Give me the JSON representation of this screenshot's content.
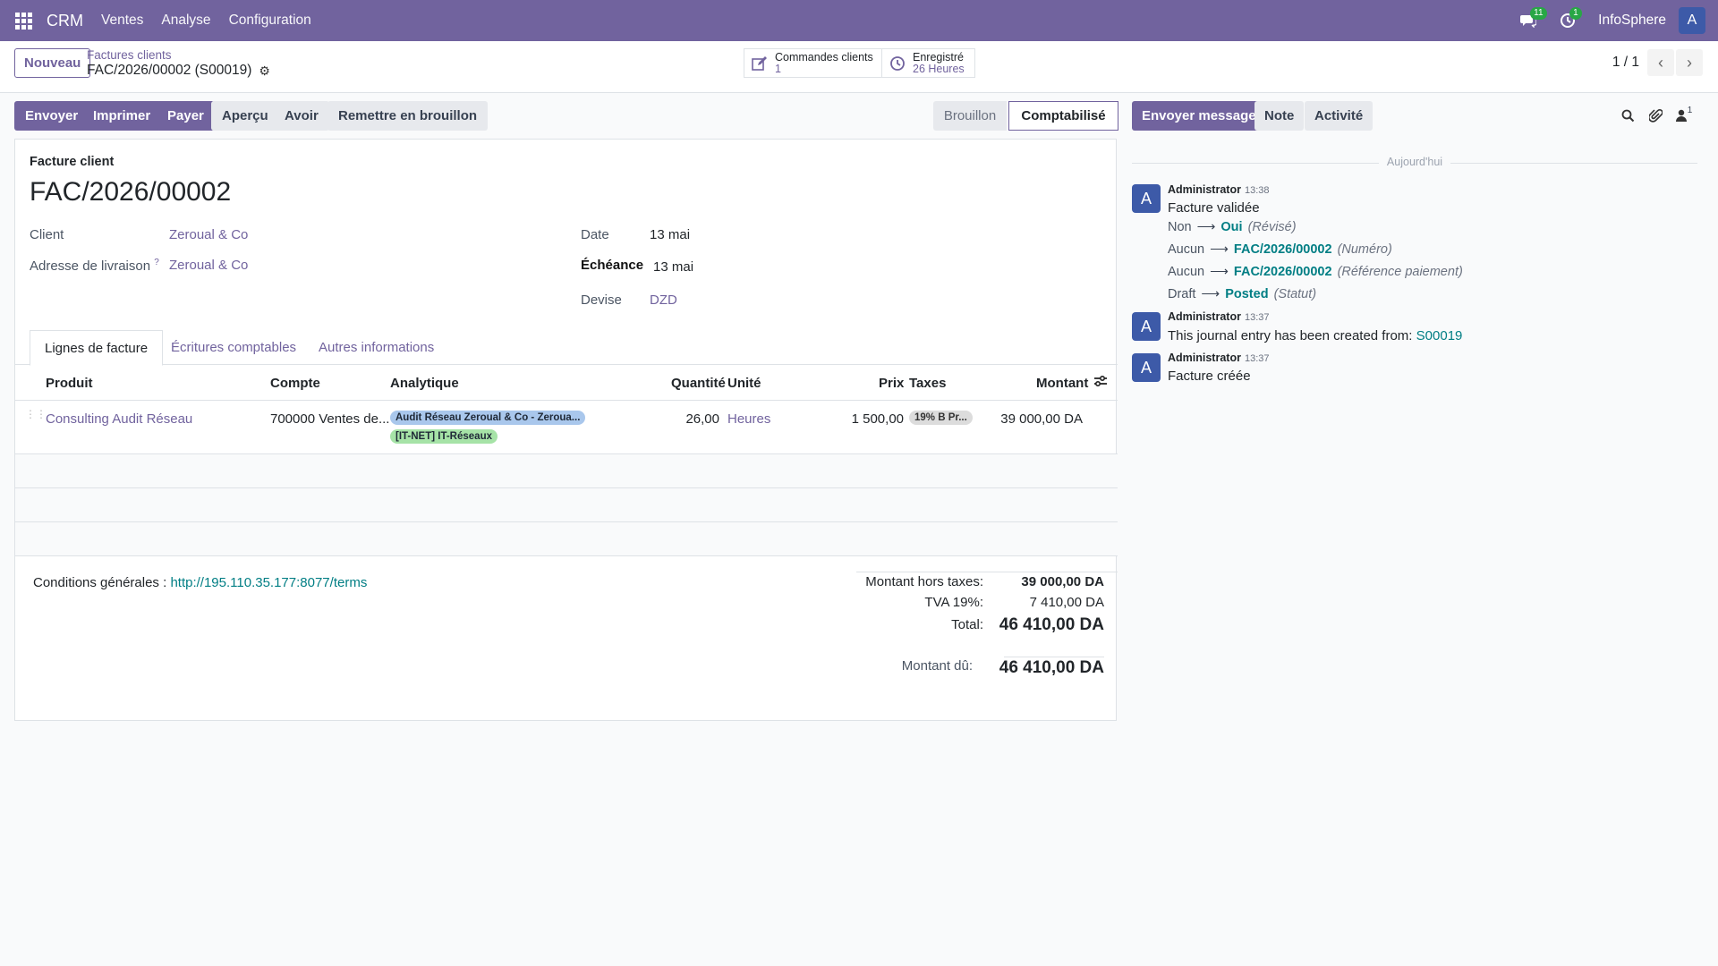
{
  "navbar": {
    "app": "CRM",
    "menus": [
      "Ventes",
      "Analyse",
      "Configuration"
    ],
    "messages_badge": "11",
    "activities_badge": "1",
    "company": "InfoSphere",
    "avatar": "A"
  },
  "control": {
    "new_label": "Nouveau",
    "breadcrumb_parent": "Factures clients",
    "breadcrumb_current": "FAC/2026/00002 (S00019)",
    "smart1_title": "Commandes clients",
    "smart1_value": "1",
    "smart2_title": "Enregistré",
    "smart2_value": "26 Heures",
    "pager": "1 / 1"
  },
  "actions": {
    "send": "Envoyer",
    "print": "Imprimer",
    "pay": "Payer",
    "preview": "Aperçu",
    "credit": "Avoir",
    "reset": "Remettre en brouillon",
    "status_draft": "Brouillon",
    "status_posted": "Comptabilisé"
  },
  "invoice": {
    "type_label": "Facture client",
    "number": "FAC/2026/00002",
    "client_label": "Client",
    "client": "Zeroual & Co",
    "delivery_label": "Adresse de livraison",
    "delivery_help": "?",
    "delivery": "Zeroual & Co",
    "date_label": "Date",
    "date": "13 mai",
    "due_label": "Échéance",
    "due": "13 mai",
    "currency_label": "Devise",
    "currency": "DZD"
  },
  "tabs": [
    "Lignes de facture",
    "Écritures comptables",
    "Autres informations"
  ],
  "table": {
    "headers": {
      "product": "Produit",
      "account": "Compte",
      "analytic": "Analytique",
      "qty": "Quantité",
      "unit": "Unité",
      "price": "Prix",
      "taxes": "Taxes",
      "amount": "Montant"
    },
    "rows": [
      {
        "product": "Consulting Audit Réseau",
        "account": "700000 Ventes de...",
        "analytic1": "Audit Réseau Zeroual & Co - Zeroua...",
        "analytic2": "[IT-NET] IT-Réseaux",
        "qty": "26,00",
        "unit": "Heures",
        "price": "1 500,00",
        "tax": "19% B Pr...",
        "amount": "39 000,00 DA"
      }
    ]
  },
  "footer": {
    "terms_label": "Conditions générales :",
    "terms_link": "http://195.110.35.177:8077/terms",
    "untaxed_label": "Montant hors taxes:",
    "untaxed": "39 000,00 DA",
    "vat_label": "TVA 19%:",
    "vat": "7 410,00 DA",
    "total_label": "Total:",
    "total": "46 410,00 DA",
    "due_label": "Montant dû:",
    "due": "46 410,00 DA"
  },
  "chatter": {
    "send_message": "Envoyer message",
    "note": "Note",
    "activity": "Activité",
    "followers_count": "1",
    "today": "Aujourd'hui",
    "messages": [
      {
        "author": "Administrator",
        "time": "13:38",
        "body": "Facture validée",
        "tracking": [
          {
            "old": "Non",
            "new": "Oui",
            "field": "(Révisé)"
          },
          {
            "old": "Aucun",
            "new": "FAC/2026/00002",
            "field": "(Numéro)"
          },
          {
            "old": "Aucun",
            "new": "FAC/2026/00002",
            "field": "(Référence paiement)"
          },
          {
            "old": "Draft",
            "new": "Posted",
            "field": "(Statut)"
          }
        ]
      },
      {
        "author": "Administrator",
        "time": "13:37",
        "body": "This journal entry has been created from:",
        "link": "S00019"
      },
      {
        "author": "Administrator",
        "time": "13:37",
        "body": "Facture créée"
      }
    ]
  }
}
